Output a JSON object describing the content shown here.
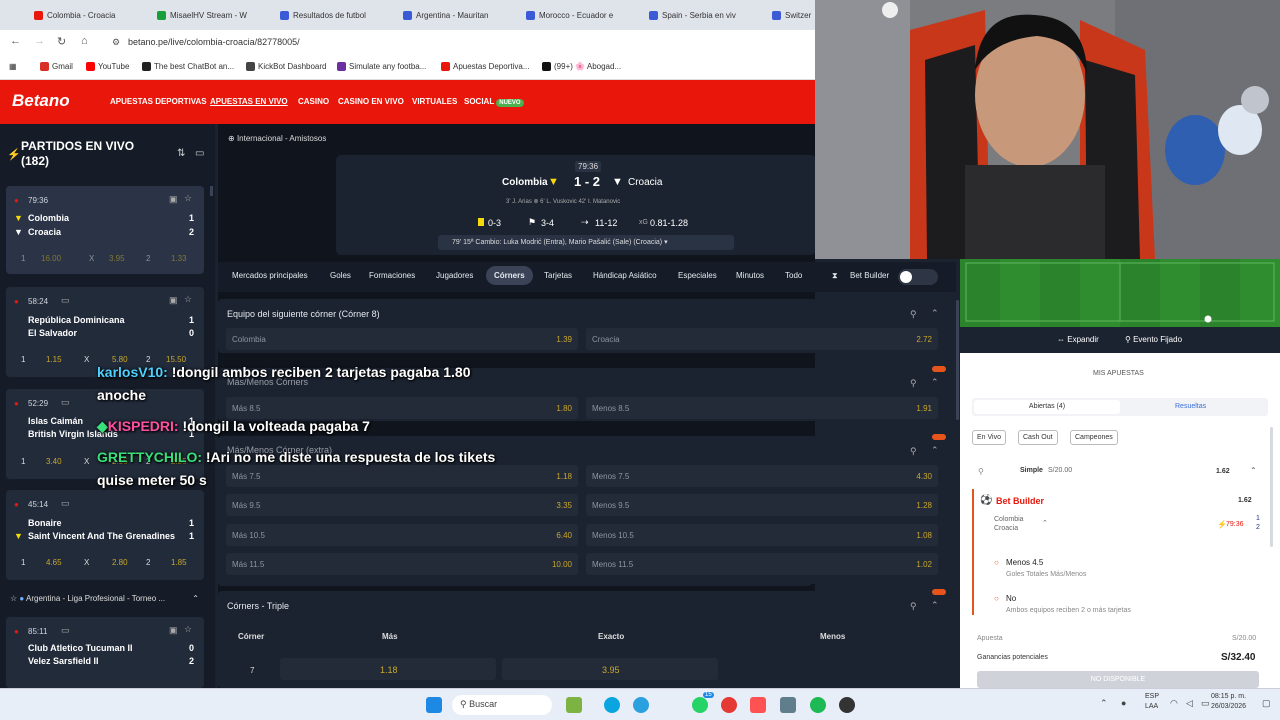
{
  "browser": {
    "tabs": [
      {
        "label": "Colombia - Croacia",
        "color": "#e8160b"
      },
      {
        "label": "MisaelHV Stream - W",
        "color": "#1a9e3a"
      },
      {
        "label": "Resultados de futbol",
        "color": "#3b5bd6"
      },
      {
        "label": "Argentina - Mauritan",
        "color": "#3b5bd6"
      },
      {
        "label": "Morocco - Ecuador e",
        "color": "#3b5bd6"
      },
      {
        "label": "Spain - Serbia en viv",
        "color": "#3b5bd6"
      },
      {
        "label": "Switzer",
        "color": "#3b5bd6"
      }
    ],
    "url": "betano.pe/live/colombia-croacia/82778005/",
    "bookmarks": [
      {
        "label": "Gmail",
        "color": "#d93025"
      },
      {
        "label": "YouTube",
        "color": "#ff0000"
      },
      {
        "label": "The best ChatBot an...",
        "color": "#222"
      },
      {
        "label": "KickBot Dashboard",
        "color": "#444"
      },
      {
        "label": "Simulate any footba...",
        "color": "#6a2fa0"
      },
      {
        "label": "Apuestas Deportiva...",
        "color": "#e8160b"
      },
      {
        "label": "(99+) 🌸 Abogad...",
        "color": "#111"
      }
    ]
  },
  "header": {
    "logo": "Betano",
    "nav": [
      "APUESTAS DEPORTIVAS",
      "APUESTAS EN VIVO",
      "CASINO",
      "CASINO EN VIVO",
      "VIRTUALES",
      "SOCIAL"
    ],
    "nuevo": "NUEVO"
  },
  "sidebar": {
    "title": "PARTIDOS EN VIVO",
    "count": "(182)",
    "matches": [
      {
        "time": "79:36",
        "home": "Colombia",
        "away": "Croacia",
        "hs": "1",
        "as": "2",
        "o1": "16.00",
        "ox": "3.95",
        "o2": "1.33",
        "l1": "1",
        "lx": "X",
        "l2": "2"
      },
      {
        "time": "58:24",
        "home": "República Dominicana",
        "away": "El Salvador",
        "hs": "1",
        "as": "0",
        "o1": "1.15",
        "ox": "5.80",
        "o2": "15.50",
        "l1": "1",
        "lx": "X",
        "l2": "2"
      },
      {
        "time": "52:29",
        "home": "Islas Caimán",
        "away": "British Virgin Islands",
        "hs": "1",
        "as": "1",
        "o1": "3.40",
        "ox": "2.15",
        "o2": "2.35",
        "l1": "1",
        "lx": "X",
        "l2": "2"
      },
      {
        "time": "45:14",
        "home": "Bonaire",
        "away": "Saint Vincent And The Grenadines",
        "hs": "1",
        "as": "1",
        "o1": "4.65",
        "ox": "2.80",
        "o2": "1.85",
        "l1": "1",
        "lx": "X",
        "l2": "2"
      }
    ],
    "league": "Argentina - Liga Profesional - Torneo ...",
    "match5": {
      "time": "85:11",
      "home": "Club Atletico Tucuman II",
      "away": "Velez Sarsfield II",
      "hs": "0",
      "as": "2"
    }
  },
  "event": {
    "competition": "Internacional - Amistosos",
    "clock": "79:36",
    "home": "Colombia",
    "away": "Croacia",
    "score": "1 - 2",
    "scorers": "3' J. Arias   ⊗ 6' L. Vuskovic   42' I. Matanovic",
    "stats": {
      "cards": "0-3",
      "corners": "3-4",
      "attacks": "11-12",
      "xg_label": "xG",
      "xg": "0.81-1.28"
    },
    "ticker": "79'  15ª Cambio: Luka Modrić (Entra), Mario Pašalić (Sale) (Croacia)"
  },
  "market_tabs": [
    "Mercados principales",
    "Goles",
    "Formaciones",
    "Jugadores",
    "Córners",
    "Tarjetas",
    "Hándicap Asiático",
    "Especiales",
    "Minutos",
    "Todo"
  ],
  "bet_builder_label": "Bet Builder",
  "markets": {
    "next_corner": {
      "title": "Equipo del siguiente córner (Córner 8)",
      "a": "Colombia",
      "av": "1.39",
      "b": "Croacia",
      "bv": "2.72"
    },
    "over_under": {
      "title": "Más/Menos Córners",
      "rows": [
        {
          "a": "Más 8.5",
          "av": "1.80",
          "b": "Menos 8.5",
          "bv": "1.91"
        }
      ]
    },
    "over_under_extra": {
      "title": "Más/Menos Córner (extra)",
      "rows": [
        {
          "a": "Más 7.5",
          "av": "1.18",
          "b": "Menos 7.5",
          "bv": "4.30"
        },
        {
          "a": "Más 9.5",
          "av": "3.35",
          "b": "Menos 9.5",
          "bv": "1.28"
        },
        {
          "a": "Más 10.5",
          "av": "6.40",
          "b": "Menos 10.5",
          "bv": "1.08"
        },
        {
          "a": "Más 11.5",
          "av": "10.00",
          "b": "Menos 11.5",
          "bv": "1.02"
        }
      ]
    },
    "triple": {
      "title": "Córners - Triple",
      "cols": [
        "Córner",
        "Más",
        "Exacto",
        "Menos"
      ],
      "row": {
        "c": "7",
        "mas": "1.18",
        "exacto": "3.95"
      }
    }
  },
  "chat": [
    {
      "user": "karlosV10:",
      "msg": "!dongil ambos reciben 2 tarjetas pagaba 1.80",
      "cont": "anoche",
      "color": "#4dd2ff"
    },
    {
      "user": "KISPEDRI:",
      "msg": "!dongil la volteada pagaba 7",
      "color": "#ff4fa3"
    },
    {
      "user": "GRETTYCHILO:",
      "msg": "!Ari no me diste una respuesta de los tikets",
      "cont": "quise meter 50 s",
      "color": "#39e07a"
    }
  ],
  "betslip": {
    "expand": "Expandir",
    "fixed": "Evento Fijado",
    "title": "MIS APUESTAS",
    "tab_open": "Abiertas (4)",
    "tab_settled": "Resueltas",
    "filters": [
      "En Vivo",
      "Cash Out",
      "Campeones"
    ],
    "bet_type": "Simple",
    "bet_stake_small": "S/20.00",
    "bet_odds": "1.62",
    "builder_label": "Bet Builder",
    "builder_odds": "1.62",
    "teams": [
      "Colombia",
      "Croacia"
    ],
    "live_time": "79:36",
    "scores": [
      "1",
      "2"
    ],
    "sel1": "Menos 4.5",
    "sel1_sub": "Goles Totales Más/Menos",
    "sel2": "No",
    "sel2_sub": "Ambos equipos reciben 2 o más tarjetas",
    "stake_label": "Apuesta",
    "stake": "S/20.00",
    "win_label": "Ganancias potenciales",
    "win": "S/32.40",
    "unavailable": "NO DISPONIBLE"
  },
  "taskbar": {
    "search": "Buscar",
    "lang1": "ESP",
    "lang2": "LAA",
    "time": "08:15 p. m.",
    "date": "26/03/2026",
    "badge": "15"
  }
}
